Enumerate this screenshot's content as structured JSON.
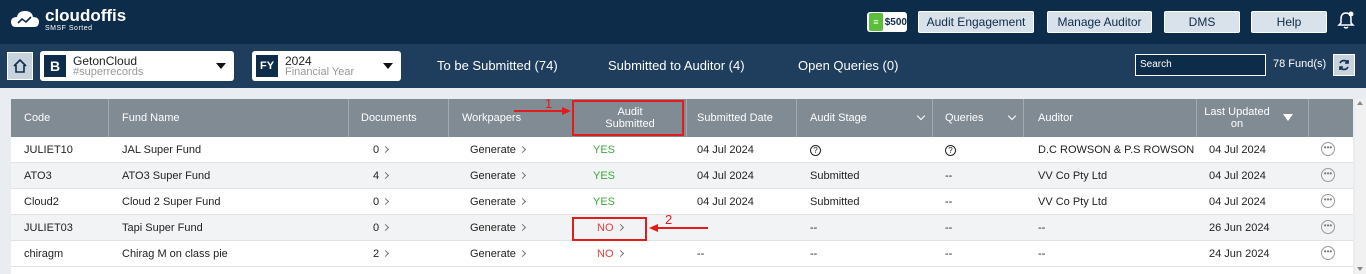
{
  "app": {
    "brand": "cloudoffis",
    "tagline": "SMSF Sorted"
  },
  "topbar": {
    "credit_amount": "$500",
    "buttons": [
      "Audit Engagement",
      "Manage Auditor",
      "DMS",
      "Help"
    ]
  },
  "subbar": {
    "entity": {
      "badge": "B",
      "name": "GetonCloud",
      "sub": "#superrecords"
    },
    "year": {
      "badge": "FY",
      "value": "2024",
      "sub": "Financial Year"
    },
    "tabs": [
      "To be Submitted (74)",
      "Submitted to Auditor (4)",
      "Open Queries (0)"
    ],
    "search_placeholder": "Search",
    "fund_count": "78 Fund(s)"
  },
  "table": {
    "headers": {
      "code": "Code",
      "fund": "Fund Name",
      "documents": "Documents",
      "workpapers": "Workpapers",
      "audit_submitted_1": "Audit",
      "audit_submitted_2": "Submitted",
      "submitted_date": "Submitted Date",
      "audit_stage": "Audit Stage",
      "queries": "Queries",
      "auditor": "Auditor",
      "last_updated_1": "Last Updated",
      "last_updated_2": "on"
    },
    "rows": [
      {
        "code": "JULIET10",
        "fund": "JAL Super Fund",
        "documents": "0",
        "workpapers": "Generate",
        "audit": "YES",
        "date": "04 Jul 2024",
        "stage": "?",
        "queries": "?",
        "auditor": "D.C ROWSON & P.S ROWSON",
        "updated": "04 Jul 2024"
      },
      {
        "code": "ATO3",
        "fund": "ATO3 Super Fund",
        "documents": "4",
        "workpapers": "Generate",
        "audit": "YES",
        "date": "04 Jul 2024",
        "stage": "Submitted",
        "queries": "--",
        "auditor": "VV Co Pty Ltd",
        "updated": "04 Jul 2024"
      },
      {
        "code": "Cloud2",
        "fund": "Cloud 2 Super Fund",
        "documents": "0",
        "workpapers": "Generate",
        "audit": "YES",
        "date": "04 Jul 2024",
        "stage": "Submitted",
        "queries": "--",
        "auditor": "VV Co Pty Ltd",
        "updated": "04 Jul 2024"
      },
      {
        "code": "JULIET03",
        "fund": "Tapi Super Fund",
        "documents": "0",
        "workpapers": "Generate",
        "audit": "NO",
        "date": "",
        "stage": "--",
        "queries": "--",
        "auditor": "--",
        "updated": "26 Jun 2024"
      },
      {
        "code": "chiragm",
        "fund": "Chirag M on class pie",
        "documents": "2",
        "workpapers": "Generate",
        "audit": "NO",
        "date": "--",
        "stage": "--",
        "queries": "--",
        "auditor": "--",
        "updated": "24 Jun 2024"
      }
    ]
  },
  "annotations": {
    "label1": "1",
    "label2": "2"
  },
  "colors": {
    "topbar": "#0d2c4a",
    "subbar": "#1f3d5c",
    "header": "#818b93",
    "annotation": "#e21b1b"
  }
}
